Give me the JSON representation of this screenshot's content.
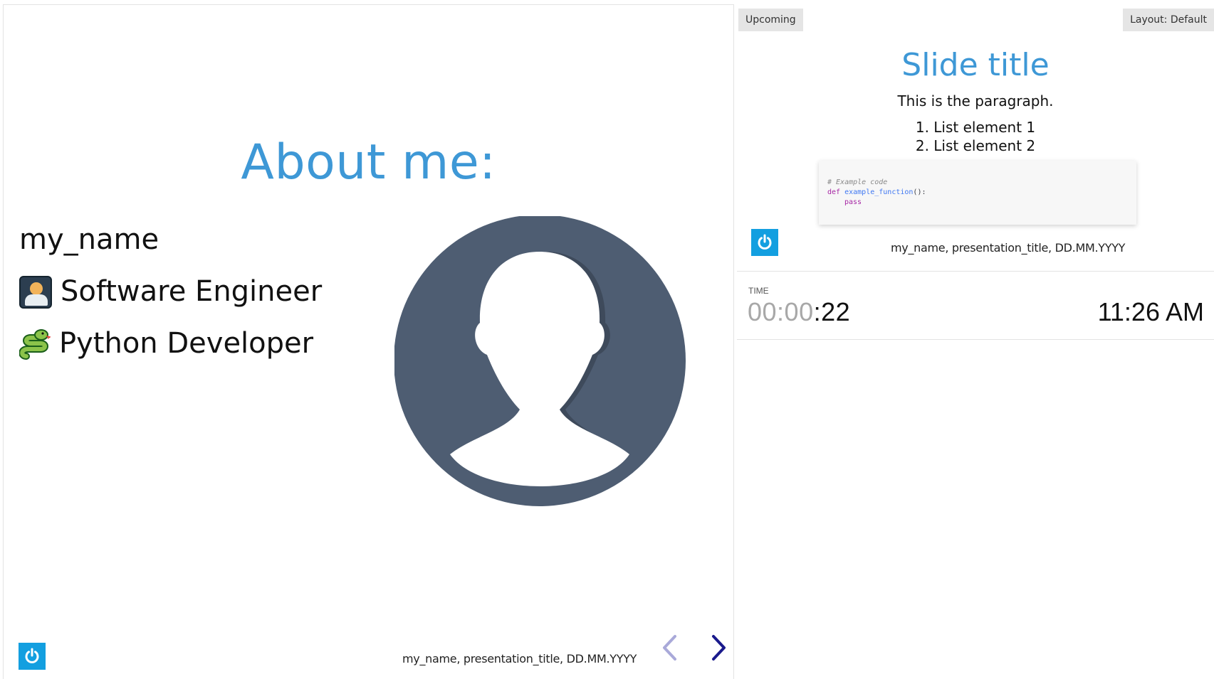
{
  "current_slide": {
    "heading": "About me:",
    "name": "my_name",
    "lines": [
      {
        "icon": "technologist-emoji-icon",
        "text": "Software Engineer"
      },
      {
        "icon": "snake-emoji-icon",
        "text": "Python Developer"
      }
    ],
    "avatar_icon": "user-avatar-icon",
    "footer_text": "my_name, presentation_title, DD.MM.YYYY",
    "logo_icon": "power-icon",
    "nav": {
      "prev_icon": "chevron-left-icon",
      "next_icon": "chevron-right-icon"
    }
  },
  "upcoming": {
    "badge": "Upcoming",
    "layout_label": "Layout: Default",
    "title": "Slide title",
    "paragraph": "This is the paragraph.",
    "list": [
      "1. List element 1",
      "2. List element 2"
    ],
    "code": {
      "comment": "# Example code",
      "keyword": "def",
      "function": "example_function",
      "punct": "():",
      "body": "pass"
    },
    "footer_text": "my_name, presentation_title, DD.MM.YYYY"
  },
  "timer": {
    "label": "TIME",
    "elapsed_dim": "00:00",
    "elapsed_bright": ":22",
    "clock": "11:26 AM"
  },
  "colors": {
    "accent": "#3e98d6",
    "logo": "#139fe0",
    "avatar": "#4e5d72",
    "nav_active": "#1a1a8c",
    "nav_inactive": "#a9a9d9"
  }
}
